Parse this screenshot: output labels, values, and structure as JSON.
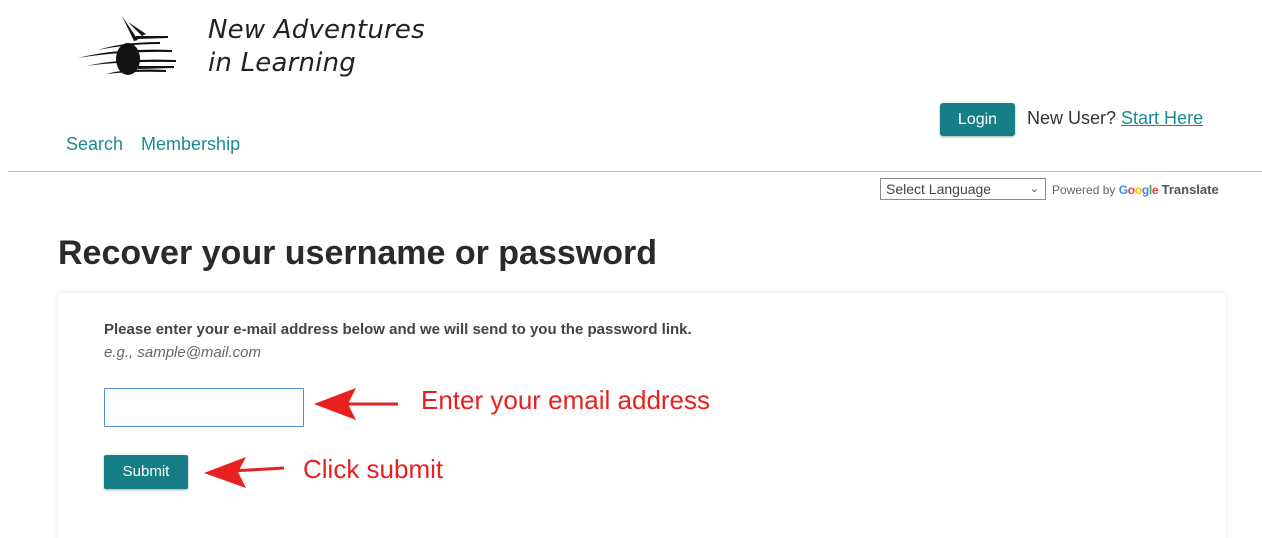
{
  "brand": {
    "line1": "New Adventures",
    "line2": "in Learning"
  },
  "nav": {
    "items": [
      {
        "label": "Search"
      },
      {
        "label": "Membership"
      }
    ]
  },
  "header": {
    "login_label": "Login",
    "new_user_prefix": "New User?",
    "start_here_label": "Start Here"
  },
  "translate": {
    "select_value": "Select Language",
    "powered_by": "Powered by",
    "google": "Google",
    "translate_label": "Translate"
  },
  "main": {
    "title": "Recover your username or password",
    "instruction": "Please enter your e-mail address below and we will send to you the password link.",
    "example": "e.g., sample@mail.com",
    "email_value": "",
    "submit_label": "Submit"
  },
  "annotations": {
    "email_hint": "Enter your email address",
    "submit_hint": "Click submit",
    "arrow_color": "#e8201f"
  },
  "colors": {
    "accent": "#177e87",
    "link": "#1b8a93"
  }
}
